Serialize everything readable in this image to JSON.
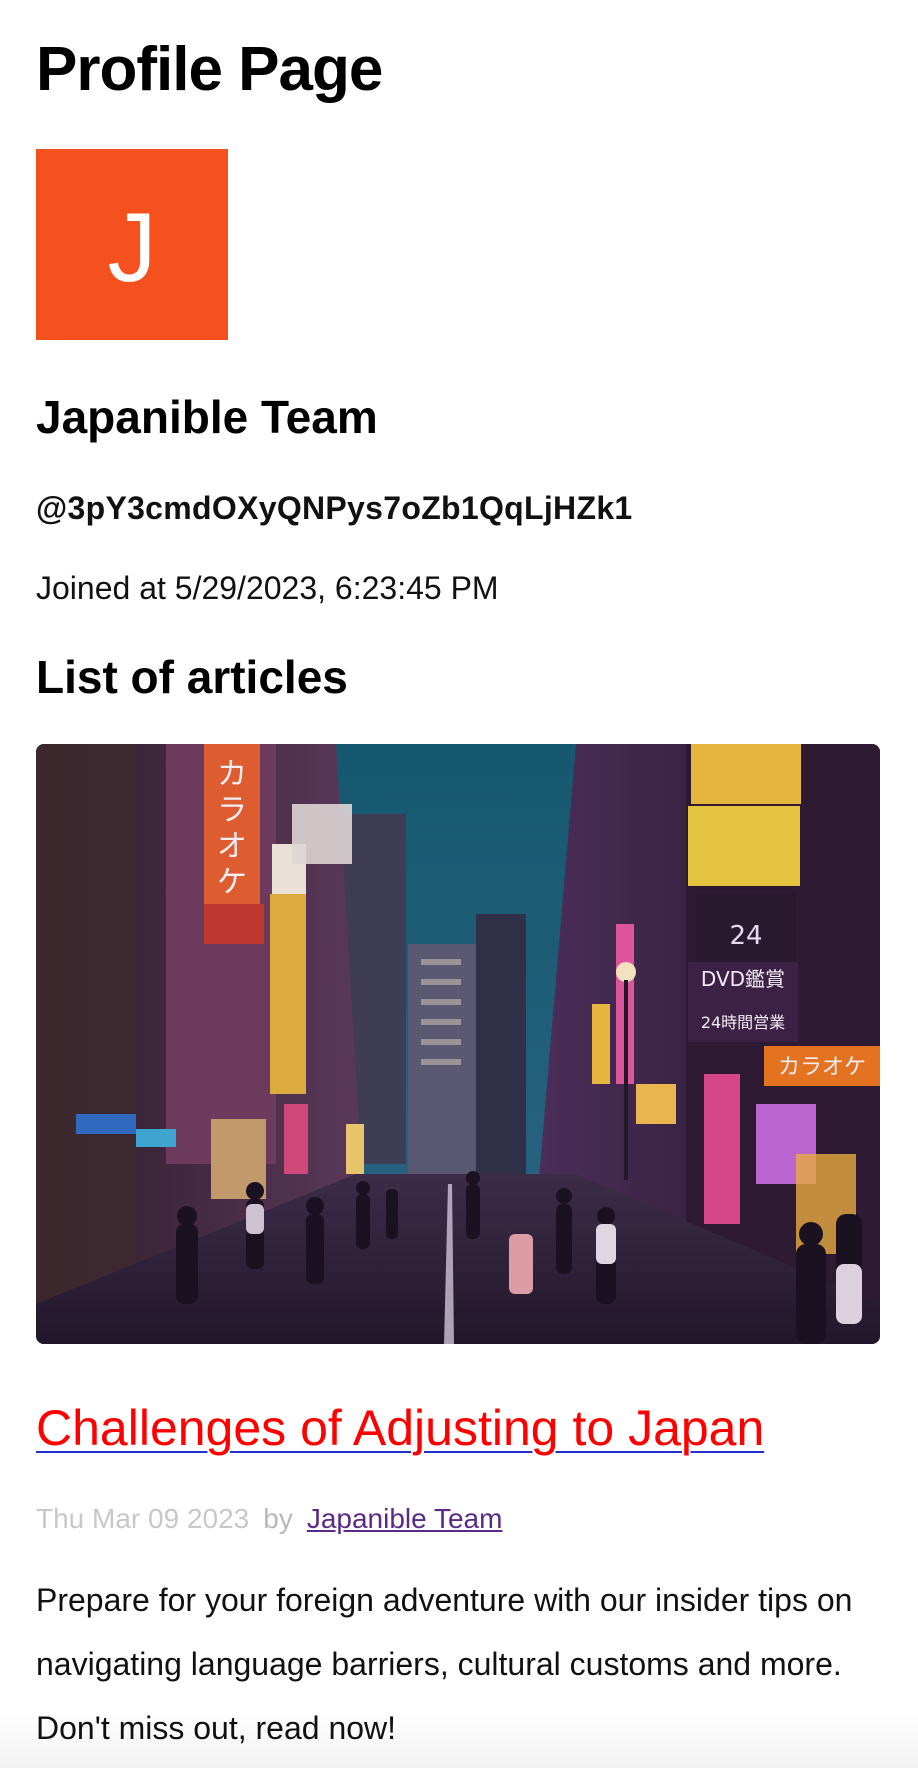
{
  "page": {
    "title": "Profile Page"
  },
  "profile": {
    "avatar_letter": "J",
    "avatar_color": "#f4511e",
    "name": "Japanible Team",
    "handle": "@3pY3cmdOXyQNPys7oZb1QqLjHZk1",
    "joined_label": "Joined at",
    "joined_value": "5/29/2023, 6:23:45 PM"
  },
  "articles_section": {
    "title": "List of articles",
    "articles": [
      {
        "title": "Challenges of Adjusting to Japan",
        "date": "Thu Mar 09 2023",
        "by_label": "by",
        "author": "Japanible Team",
        "excerpt": "Prepare for your foreign adventure with our insider tips on navigating language barriers, cultural customs and more. Don't miss out, read now!",
        "image_signs": [
          "カラオケ",
          "カラオケ",
          "DVD鑑賞",
          "24時間営業"
        ]
      }
    ]
  },
  "colors": {
    "link_title": "#ff0000",
    "link_underline": "#2233cc",
    "author_link": "#5b2a86",
    "meta_date": "#c8c8c8"
  }
}
